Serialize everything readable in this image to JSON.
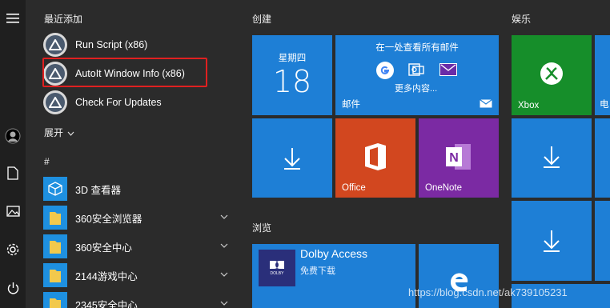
{
  "recent": {
    "title": "最近添加",
    "items": [
      {
        "label": "Run Script (x86)"
      },
      {
        "label": "AutoIt Window Info (x86)"
      },
      {
        "label": "Check For Updates"
      }
    ],
    "expand_label": "展开"
  },
  "hash_label": "#",
  "apps": [
    {
      "label": "3D 查看器"
    },
    {
      "label": "360安全浏览器"
    },
    {
      "label": "360安全中心"
    },
    {
      "label": "2144游戏中心"
    },
    {
      "label": "2345安全中心"
    }
  ],
  "groups": {
    "create": "创建",
    "browse": "浏览",
    "entertainment": "娱乐"
  },
  "tiles": {
    "calendar": {
      "weekday": "星期四",
      "day": "18"
    },
    "mail": {
      "title": "在一处查看所有邮件",
      "more": "更多内容...",
      "label": "邮件"
    },
    "office": {
      "label": "Office"
    },
    "onenote": {
      "label": "OneNote"
    },
    "xbox": {
      "label": "Xbox"
    },
    "partial": {
      "label": "电"
    },
    "dolby": {
      "name": "Dolby Access",
      "sub": "免费下载",
      "logo": "DOLBY"
    }
  },
  "watermark": "https://blog.csdn.net/ak739105231",
  "colors": {
    "tile_blue": "#1e7fd6",
    "office_orange": "#d2471f",
    "onenote_purple": "#7b2aa3",
    "xbox_green": "#168e2a",
    "highlight": "#e02020"
  }
}
